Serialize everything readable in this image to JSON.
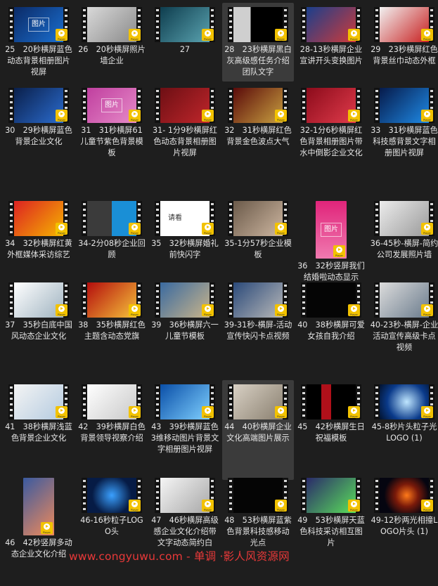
{
  "items": [
    {
      "caption": "25　20秒横屏蓝色动态背景相册图片视屏",
      "thumb_text": "图片",
      "bg": "linear-gradient(135deg,#0b2a66,#1b6fd0)"
    },
    {
      "caption": "26　20秒横屏照片墙企业",
      "thumb_text": "",
      "bg": "linear-gradient(135deg,#d9d9d9,#8a8a8a)"
    },
    {
      "caption": "27",
      "thumb_text": "",
      "bg": "linear-gradient(135deg,#0e3d4e,#5aa3b0)"
    },
    {
      "caption": "28　23秒横屏黑白灰高级感任务介绍团队文字",
      "thumb_text": "",
      "bg": "linear-gradient(90deg,#cfcfcf 0 35%,#000 35%)"
    },
    {
      "caption": "28-13秒横屏企业宣讲开头变换图片",
      "thumb_text": "",
      "bg": "linear-gradient(135deg,#1a3f8c,#cf3a3a)"
    },
    {
      "caption": "29　23秒横屏红色背景丝巾动态外框",
      "thumb_text": "",
      "bg": "linear-gradient(135deg,#f1f1f1,#c81f1f)"
    },
    {
      "caption": "30　29秒横屏蓝色背景企业文化",
      "thumb_text": "",
      "bg": "linear-gradient(135deg,#0a1f4a,#2b6ccf)"
    },
    {
      "caption": "31　31秒横屏61儿童节紫色背景模板",
      "thumb_text": "图片",
      "bg": "linear-gradient(135deg,#c03f9f,#e68ac8)"
    },
    {
      "caption": "31- 1分9秒横屏红色动态背景相册图片视屏",
      "thumb_text": "",
      "bg": "linear-gradient(135deg,#6d0f14,#c0262b)"
    },
    {
      "caption": "32　31秒横屏红色背景金色波点大气",
      "thumb_text": "",
      "bg": "linear-gradient(135deg,#5a0a0a,#c8a040)"
    },
    {
      "caption": "32-1分6秒横屏红色背景相册图片带水中倒影企业文化",
      "thumb_text": "",
      "bg": "linear-gradient(135deg,#8c0b1b,#e03b4b)"
    },
    {
      "caption": "33　31秒横屏蓝色科技感背景文字相册图片视屏",
      "thumb_text": "",
      "bg": "linear-gradient(135deg,#061a4a,#1f8ae6)"
    },
    {
      "caption": "34　32秒横屏红黄外框媒体采访综艺",
      "thumb_text": "",
      "bg": "linear-gradient(135deg,#d22,#f5b400)"
    },
    {
      "caption": "34-2分08秒企业回顾",
      "thumb_text": "",
      "bg": "linear-gradient(90deg,#3b3b3b 0 50%,#1a8fd6 50%)"
    },
    {
      "caption": "35　32秒横屏婚礼前快闪字",
      "thumb_text": "请看",
      "bg": "#ffffff"
    },
    {
      "caption": "35-1分57秒企业模板",
      "thumb_text": "",
      "bg": "linear-gradient(135deg,#6b5a4a,#cdb6a0)"
    },
    {
      "caption": "36　32秒竖屏我们结婚啦动态显示",
      "thumb_text": "图片",
      "bg": "linear-gradient(180deg,#e0247a,#f07ab0)",
      "tall": true
    },
    {
      "caption": "36-45秒-横屏-简约公司发展照片墙",
      "thumb_text": "",
      "bg": "linear-gradient(135deg,#ececec,#9a9a9a)"
    },
    {
      "caption": "37　35秒白底中国风动态企业文化",
      "thumb_text": "",
      "bg": "linear-gradient(135deg,#ffffff,#9fb3c0)"
    },
    {
      "caption": "38　35秒横屏红色主题含动态党旗",
      "thumb_text": "",
      "bg": "linear-gradient(135deg,#b40d0d,#f5c23a)"
    },
    {
      "caption": "39　36秒横屏六一儿童节模板",
      "thumb_text": "",
      "bg": "linear-gradient(135deg,#3a6aa0,#c9b48a)"
    },
    {
      "caption": "39-31秒-横屏-活动宣传快闪卡点视频",
      "thumb_text": "",
      "bg": "linear-gradient(135deg,#2b4a7a,#b8b8b8)"
    },
    {
      "caption": "40　38秒横屏可爱女孩自我介绍",
      "thumb_text": "",
      "bg": "#050505"
    },
    {
      "caption": "40-23秒-横屏-企业活动宣传高级卡点视频",
      "thumb_text": "",
      "bg": "linear-gradient(135deg,#dcdcdc,#6a7b8c)"
    },
    {
      "caption": "41　38秒横屏浅蓝色背景企业文化",
      "thumb_text": "",
      "bg": "linear-gradient(135deg,#f4f4f4,#b4cbe0)"
    },
    {
      "caption": "42　39秒横屏白色背景领导视察介绍",
      "thumb_text": "",
      "bg": "linear-gradient(135deg,#ffffff,#c9c9c9)"
    },
    {
      "caption": "43　39秒横屏蓝色3维移动图片背景文字相册图片视屏",
      "thumb_text": "",
      "bg": "linear-gradient(135deg,#0a4fa8,#7fd0ff)"
    },
    {
      "caption": "44　40秒横屏企业文化高端图片展示",
      "thumb_text": "",
      "bg": "linear-gradient(135deg,#d8d0c4,#8a8070)"
    },
    {
      "caption": "45　42秒横屏生日祝福模板",
      "thumb_text": "",
      "bg": "linear-gradient(90deg,#000 0 30%,#b0101a 30% 50%,#000 50%)"
    },
    {
      "caption": "45-8秒片头粒子光LOGO (1)",
      "thumb_text": "",
      "bg": "radial-gradient(circle at 55% 50%,#bfe6ff,#0a3a8a 60%,#02112a)"
    },
    {
      "caption": "46　42秒竖屏多动态企业文化介绍",
      "thumb_text": "",
      "bg": "linear-gradient(135deg,#3a5aa0,#f08a5a)",
      "tall": true
    },
    {
      "caption": "46-16秒粒子LOGO头",
      "thumb_text": "",
      "bg": "radial-gradient(circle at 50% 50%,#3aa0ff,#061b45 65%)"
    },
    {
      "caption": "47　46秒横屏高级感企业文化介绍带文字动态简约白",
      "thumb_text": "",
      "bg": "linear-gradient(135deg,#f5f5f5,#a8a8a8)"
    },
    {
      "caption": "48　53秒横屏蓝紫色背景科技感移动光点",
      "thumb_text": "",
      "bg": "#050505"
    },
    {
      "caption": "49　53秒横屏天蓝色科技采访相互图片",
      "thumb_text": "",
      "bg": "linear-gradient(135deg,#2a2a6a,#5ae05a)"
    },
    {
      "caption": "49-12秒两光相撞LOGO片头 (1)",
      "thumb_text": "",
      "bg": "radial-gradient(circle at 55% 50%,#ff7a1a,#7a1a0a 35%,#050510 70%)"
    }
  ],
  "badge_label": "Player",
  "watermark": "www.congyuwu.com - 单调 ·影人风资源网"
}
